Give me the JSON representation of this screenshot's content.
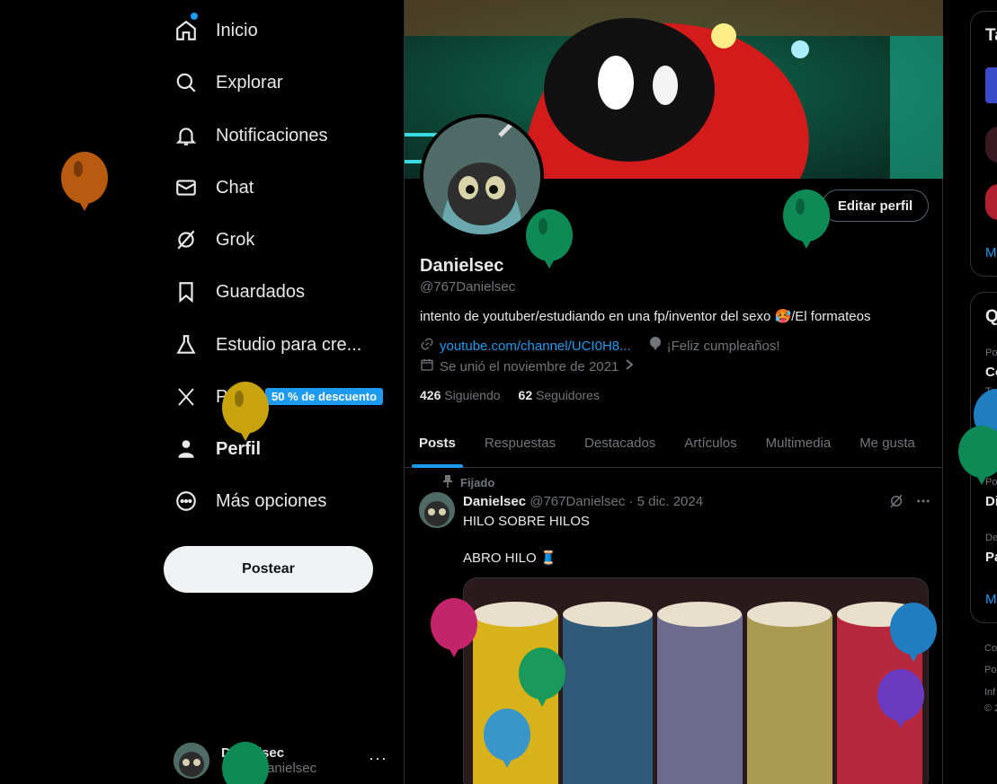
{
  "nav": {
    "items": [
      {
        "label": "Inicio",
        "icon": "home-icon"
      },
      {
        "label": "Explorar",
        "icon": "search-icon"
      },
      {
        "label": "Notificaciones",
        "icon": "bell-icon"
      },
      {
        "label": "Chat",
        "icon": "mail-icon"
      },
      {
        "label": "Grok",
        "icon": "grok-icon"
      },
      {
        "label": "Guardados",
        "icon": "bookmark-icon"
      },
      {
        "label": "Estudio para cre...",
        "icon": "flask-icon"
      },
      {
        "label": "Pr",
        "icon": "x-logo-icon"
      },
      {
        "label": "Perfil",
        "icon": "person-icon"
      },
      {
        "label": "Más opciones",
        "icon": "more-circle-icon"
      }
    ],
    "premium_badge": "50 % de descuento",
    "post_button": "Postear"
  },
  "account": {
    "name": "Danielsec",
    "handle": "@767Danielsec",
    "more": "···"
  },
  "profile": {
    "edit_button": "Editar perfil",
    "name": "Danielsec",
    "handle": "@767Danielsec",
    "bio": "intento de youtuber/estudiando en una fp/inventor del sexo 🥵/El formateos",
    "link": "youtube.com/channel/UCI0H8...",
    "birthday": "¡Feliz cumpleaños!",
    "joined": "Se unió el noviembre de 2021",
    "following_count": "426",
    "following_label": "Siguiendo",
    "followers_count": "62",
    "followers_label": "Seguidores"
  },
  "tabs": [
    "Posts",
    "Respuestas",
    "Destacados",
    "Artículos",
    "Multimedia",
    "Me gusta"
  ],
  "tweet": {
    "pinned_label": "Fijado",
    "author": "Danielsec",
    "handle_date": "@767Danielsec · 5 dic. 2024",
    "line1": "HILO SOBRE HILOS",
    "line2": "ABRO HILO 🧵"
  },
  "right": {
    "card1_title": "Ta",
    "card1_more": "M",
    "card2_title": "Q",
    "rows": [
      "Po",
      "Co",
      "Te",
      "De",
      "Fe",
      "Po",
      "Di",
      "De",
      "Pa"
    ],
    "card2_more": "M",
    "footer": [
      "Co",
      "Po",
      "Inf",
      "© 2"
    ]
  },
  "colors": {
    "accent": "#1d9bf0",
    "background": "#000000",
    "text": "#e7e9ea",
    "muted": "#71767b",
    "border": "#2f3336"
  }
}
